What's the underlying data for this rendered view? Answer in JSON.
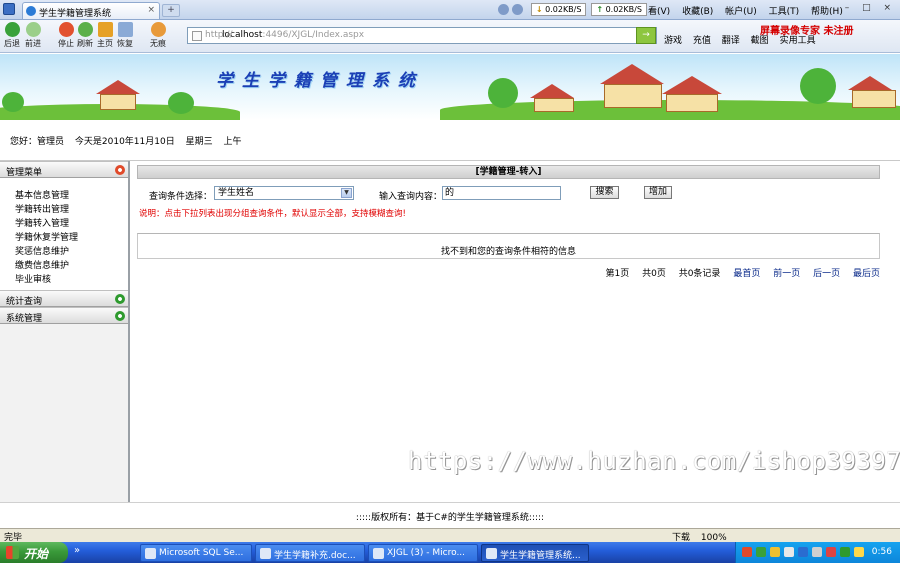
{
  "browser": {
    "tab_title": "学生学籍管理系统",
    "tab_close": "×",
    "tab_new": "+",
    "speed_up": "0.02KB/S",
    "speed_down": "0.02KB/S",
    "menu": [
      "看(V)",
      "收藏(B)",
      "帐户(U)",
      "工具(T)",
      "帮助(H)"
    ],
    "window_controls": "– □ ×",
    "nav": [
      {
        "label": "后退",
        "icon": "back-arrow-icon"
      },
      {
        "label": "前进",
        "icon": "forward-arrow-icon"
      },
      {
        "label": "停止",
        "icon": "stop-icon"
      },
      {
        "label": "刷新",
        "icon": "refresh-icon"
      },
      {
        "label": "主页",
        "icon": "home-icon"
      },
      {
        "label": "恢复",
        "icon": "restore-icon"
      },
      {
        "label": "无痕",
        "icon": "incognito-icon"
      }
    ],
    "address_prefix": "http://",
    "address_host": "localhost",
    "address_path": ":4496/XJGL/Index.aspx",
    "go_label": "→",
    "recorder_notice": "屏幕录像专家 未注册",
    "right_tools": [
      "游戏",
      "充值",
      "翻译",
      "截图",
      "实用工具"
    ]
  },
  "page": {
    "banner_title": "学生学籍管理系统",
    "user_line": {
      "greeting": "您好：管理员",
      "date": "今天是2010年11月10日",
      "weekday": "星期三",
      "period": "上午"
    },
    "sidebar": {
      "sections": [
        {
          "title": "管理菜单",
          "expanded": true,
          "marker_color": "#e04a2a"
        },
        {
          "title": "统计查询",
          "expanded": false,
          "marker_color": "#2e9a2e"
        },
        {
          "title": "系统管理",
          "expanded": false,
          "marker_color": "#2e9a2e"
        }
      ],
      "items": [
        "基本信息管理",
        "学籍转出管理",
        "学籍转入管理",
        "学籍休复学管理",
        "奖惩信息维护",
        "缴费信息维护",
        "毕业审核"
      ]
    },
    "panel_title": "[学籍管理-转入]",
    "search": {
      "condition_label": "查询条件选择：",
      "condition_value": "学生姓名",
      "keyword_label": "输入查询内容：",
      "keyword_value": "的",
      "search_button": "搜索",
      "add_button": "增加"
    },
    "hint": "说明：点击下拉列表出现分组查询条件，默认显示全部，支持模糊查询!",
    "empty_result": "找不到和您的查询条件相符的信息",
    "pager": {
      "current": "第1页",
      "total_pages": "共0页",
      "total_records": "共0条记录",
      "first": "最首页",
      "prev": "前一页",
      "next": "后一页",
      "last": "最后页"
    },
    "watermark": "https://www.huzhan.com/ishop39397",
    "footer": ":::::版权所有：基于C#的学生学籍管理系统:::::"
  },
  "statusbar": {
    "status": "完毕",
    "download": "下载",
    "zoom": "100%"
  },
  "taskbar": {
    "start": "开始",
    "quick_more": "»",
    "tasks": [
      {
        "label": "Microsoft SQL Se...",
        "active": false
      },
      {
        "label": "学生学籍补充.doc...",
        "active": false
      },
      {
        "label": "XJGL (3) - Micro...",
        "active": false
      },
      {
        "label": "学生学籍管理系统...",
        "active": true
      }
    ],
    "clock": "0:56"
  }
}
